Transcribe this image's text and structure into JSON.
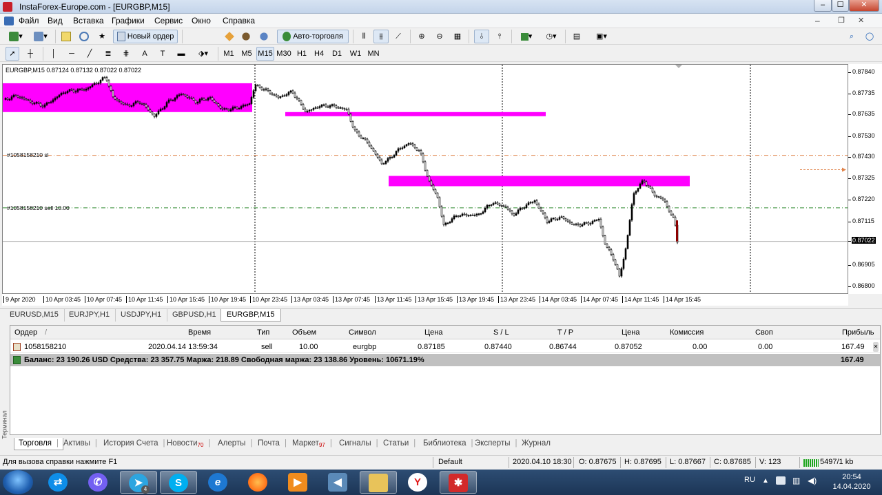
{
  "window": {
    "title": "InstaForex-Europe.com - [EURGBP,M15]",
    "btn_min": "‒",
    "btn_max": "☐",
    "btn_close": "✕"
  },
  "menu": [
    "Файл",
    "Вид",
    "Вставка",
    "Графики",
    "Сервис",
    "Окно",
    "Справка"
  ],
  "toolbar1": {
    "new_order": "Новый ордер",
    "auto_trading": "Авто-торговля"
  },
  "timeframes": [
    "M1",
    "M5",
    "M15",
    "M30",
    "H1",
    "H4",
    "D1",
    "W1",
    "MN"
  ],
  "active_timeframe": "M15",
  "chart": {
    "info": "EURGBP,M15  0.87124 0.87132 0.87022 0.87022",
    "sl_label": "#1058158210 sl",
    "order_label": "#1058158210 sell 10.00",
    "price_axis": [
      "0.87840",
      "0.87735",
      "0.87635",
      "0.87530",
      "0.87430",
      "0.87325",
      "0.87220",
      "0.87115",
      "0.87022",
      "0.86905",
      "0.86800"
    ],
    "current_price": "0.87022",
    "time_axis": [
      "9 Apr 2020",
      "10 Apr 03:45",
      "10 Apr 07:45",
      "10 Apr 11:45",
      "10 Apr 15:45",
      "10 Apr 19:45",
      "10 Apr 23:45",
      "13 Apr 03:45",
      "13 Apr 07:45",
      "13 Apr 11:45",
      "13 Apr 15:45",
      "13 Apr 19:45",
      "13 Apr 23:45",
      "14 Apr 03:45",
      "14 Apr 07:45",
      "14 Apr 11:45",
      "14 Apr 15:45"
    ],
    "zone_color": "#ff00ff",
    "bull_color": "#000000",
    "bear_color": "#ffffff"
  },
  "chart_tabs": [
    "EURUSD,M15",
    "EURJPY,H1",
    "USDJPY,H1",
    "GBPUSD,H1",
    "EURGBP,M15"
  ],
  "active_chart_tab": "EURGBP,M15",
  "terminal": {
    "columns": [
      "Ордер",
      "Время",
      "Тип",
      "Объем",
      "Символ",
      "Цена",
      "S / L",
      "T / P",
      "Цена",
      "Комиссия",
      "Своп",
      "Прибыль"
    ],
    "sort_mark": "/",
    "order": {
      "id": "1058158210",
      "time": "2020.04.14 13:59:34",
      "type": "sell",
      "volume": "10.00",
      "symbol": "eurgbp",
      "price": "0.87185",
      "sl": "0.87440",
      "tp": "0.86744",
      "cur_price": "0.87052",
      "commission": "0.00",
      "swap": "0.00",
      "profit": "167.49"
    },
    "balance_line": "Баланс: 23 190.26 USD  Средства: 23 357.75  Маржа: 218.89  Свободная маржа: 23 138.86  Уровень: 10671.19%",
    "balance_profit": "167.49",
    "side_label": "Терминал"
  },
  "terminal_tabs": [
    {
      "label": "Торговля",
      "badge": ""
    },
    {
      "label": "Активы",
      "badge": ""
    },
    {
      "label": "История Счета",
      "badge": ""
    },
    {
      "label": "Новости",
      "badge": "70"
    },
    {
      "label": "Алерты",
      "badge": ""
    },
    {
      "label": "Почта",
      "badge": ""
    },
    {
      "label": "Маркет",
      "badge": "97"
    },
    {
      "label": "Сигналы",
      "badge": ""
    },
    {
      "label": "Статьи",
      "badge": ""
    },
    {
      "label": "Библиотека",
      "badge": ""
    },
    {
      "label": "Эксперты",
      "badge": ""
    },
    {
      "label": "Журнал",
      "badge": ""
    }
  ],
  "status": {
    "help": "Для вызова справки нажмите F1",
    "profile": "Default",
    "datetime": "2020.04.10 18:30",
    "open": "O: 0.87675",
    "high": "H: 0.87695",
    "low": "L: 0.87667",
    "close": "C: 0.87685",
    "volume": "V: 123",
    "traffic": "5497/1 kb"
  },
  "taskbar": {
    "lang": "RU",
    "time": "20:54",
    "date": "14.04.2020",
    "telegram_badge": "4"
  }
}
